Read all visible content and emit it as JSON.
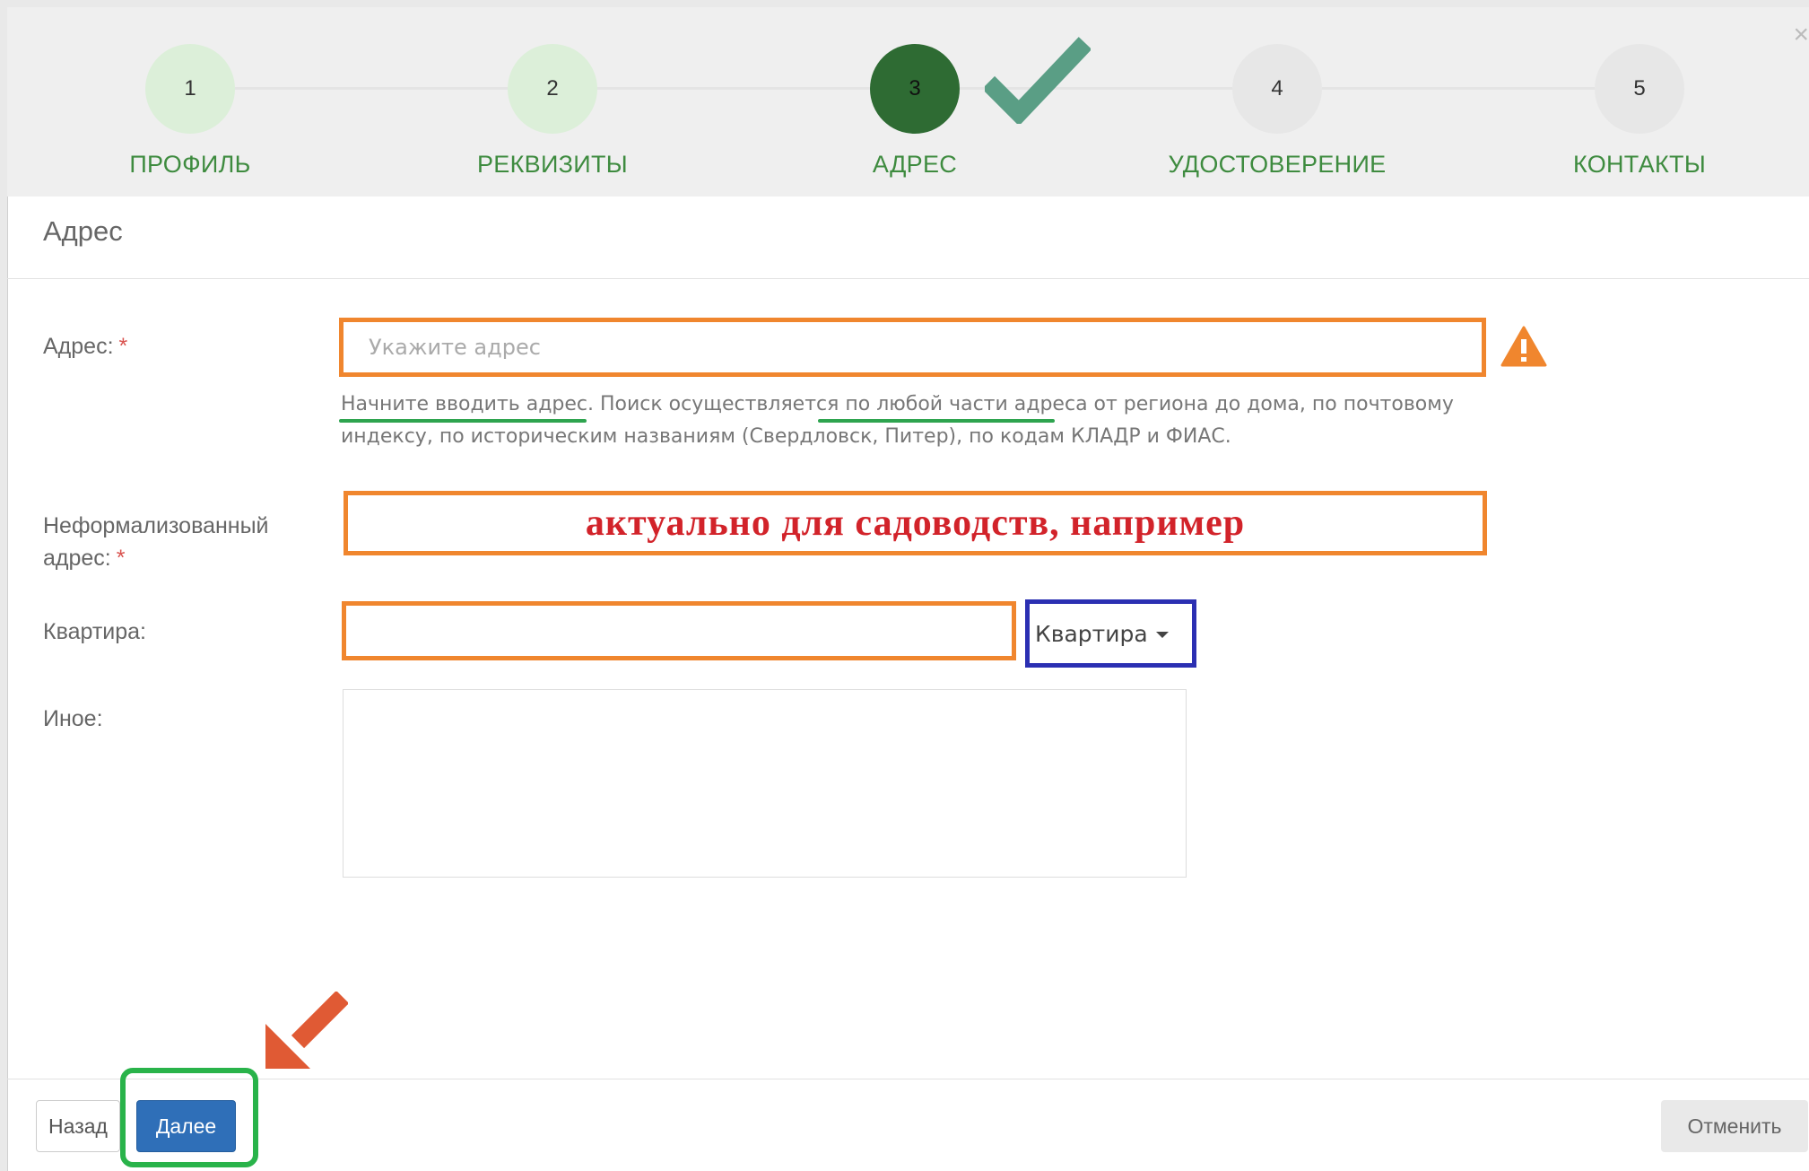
{
  "wizard": {
    "steps": [
      {
        "number": "1",
        "label": "ПРОФИЛЬ",
        "state": "done"
      },
      {
        "number": "2",
        "label": "РЕКВИЗИТЫ",
        "state": "done"
      },
      {
        "number": "3",
        "label": "АДРЕС",
        "state": "active"
      },
      {
        "number": "4",
        "label": "УДОСТОВЕРЕНИЕ",
        "state": "todo"
      },
      {
        "number": "5",
        "label": "КОНТАКТЫ",
        "state": "todo"
      }
    ],
    "close_glyph": "×"
  },
  "section": {
    "title": "Адрес"
  },
  "form": {
    "address": {
      "label": "Адрес:",
      "required_mark": "*",
      "placeholder": "Укажите адрес",
      "help_part1": "Начните вводить адрес",
      "help_part2": ". Поиск осуществляется ",
      "help_part3": "по любой части адреса",
      "help_part4": " от региона до дома, по почтовому индексу, по историческим названиям (Свердловск, Питер), по кодам КЛАДР и ФИАС.",
      "warning_icon": "warning-triangle-icon"
    },
    "informal_address": {
      "label_line1": "Неформализованный",
      "label_line2": "адрес:",
      "required_mark": "*",
      "annotation": "актуально для садоводств, например"
    },
    "apartment": {
      "label": "Квартира:",
      "type_selected": "Квартира"
    },
    "other": {
      "label": "Иное:"
    }
  },
  "footer": {
    "back_label": "Назад",
    "next_label": "Далее",
    "cancel_label": "Отменить"
  },
  "colors": {
    "step_label": "#3e8b3f",
    "step_done": "#dcefd9",
    "step_active": "#2e6b33",
    "annotation_orange": "#f0862e",
    "annotation_blue": "#2b2fb2",
    "annotation_green": "#29b34a",
    "annotation_red_text": "#d2232a",
    "primary_button": "#2f6fb8"
  }
}
